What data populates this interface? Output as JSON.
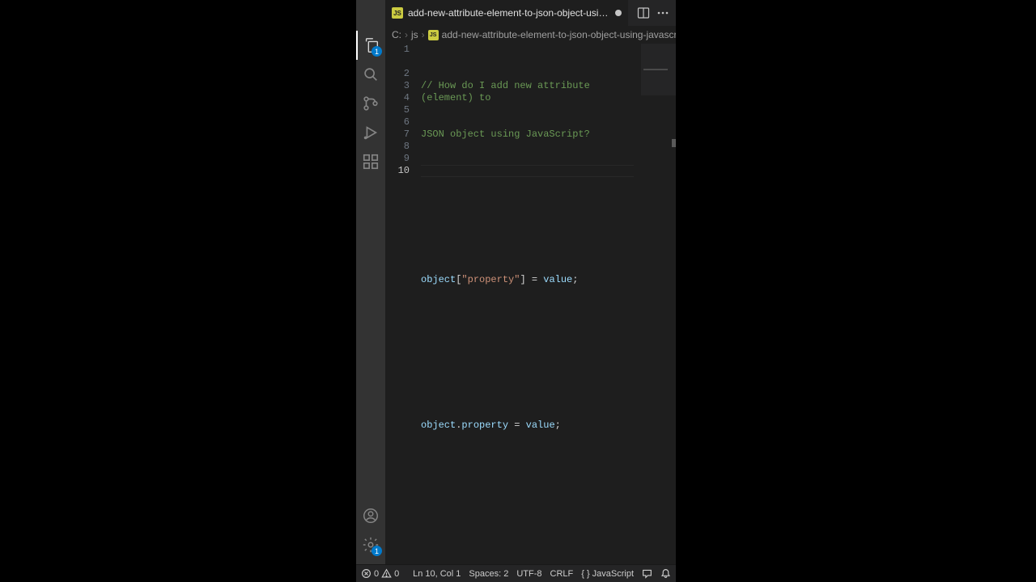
{
  "tab": {
    "file_icon_text": "JS",
    "filename": "add-new-attribute-element-to-json-object-using-javascript.js",
    "dirty": true
  },
  "breadcrumb": {
    "seg1": "C:",
    "seg2": "js",
    "file_icon_text": "JS",
    "filename": "add-new-attribute-element-to-json-object-using-javascript.js"
  },
  "activity": {
    "explorer_badge": "1",
    "settings_badge": "1"
  },
  "editor": {
    "line_count": 10,
    "current_line": 10,
    "lines": {
      "l1a": "// How do I add new attribute (element) to ",
      "l1b": "JSON object using JavaScript?",
      "l5_var1": "object",
      "l5_b1": "[",
      "l5_str": "\"property\"",
      "l5_b2": "]",
      "l5_eq": " = ",
      "l5_var2": "value",
      "l5_semi": ";",
      "l9_var1": "object",
      "l9_dot": ".",
      "l9_prop": "property",
      "l9_eq": " = ",
      "l9_var2": "value",
      "l9_semi": ";"
    }
  },
  "status": {
    "errors": "0",
    "warnings": "0",
    "cursor": "Ln 10, Col 1",
    "spaces": "Spaces: 2",
    "encoding": "UTF-8",
    "eol": "CRLF",
    "lang_icon": "{ }",
    "language": "JavaScript"
  }
}
